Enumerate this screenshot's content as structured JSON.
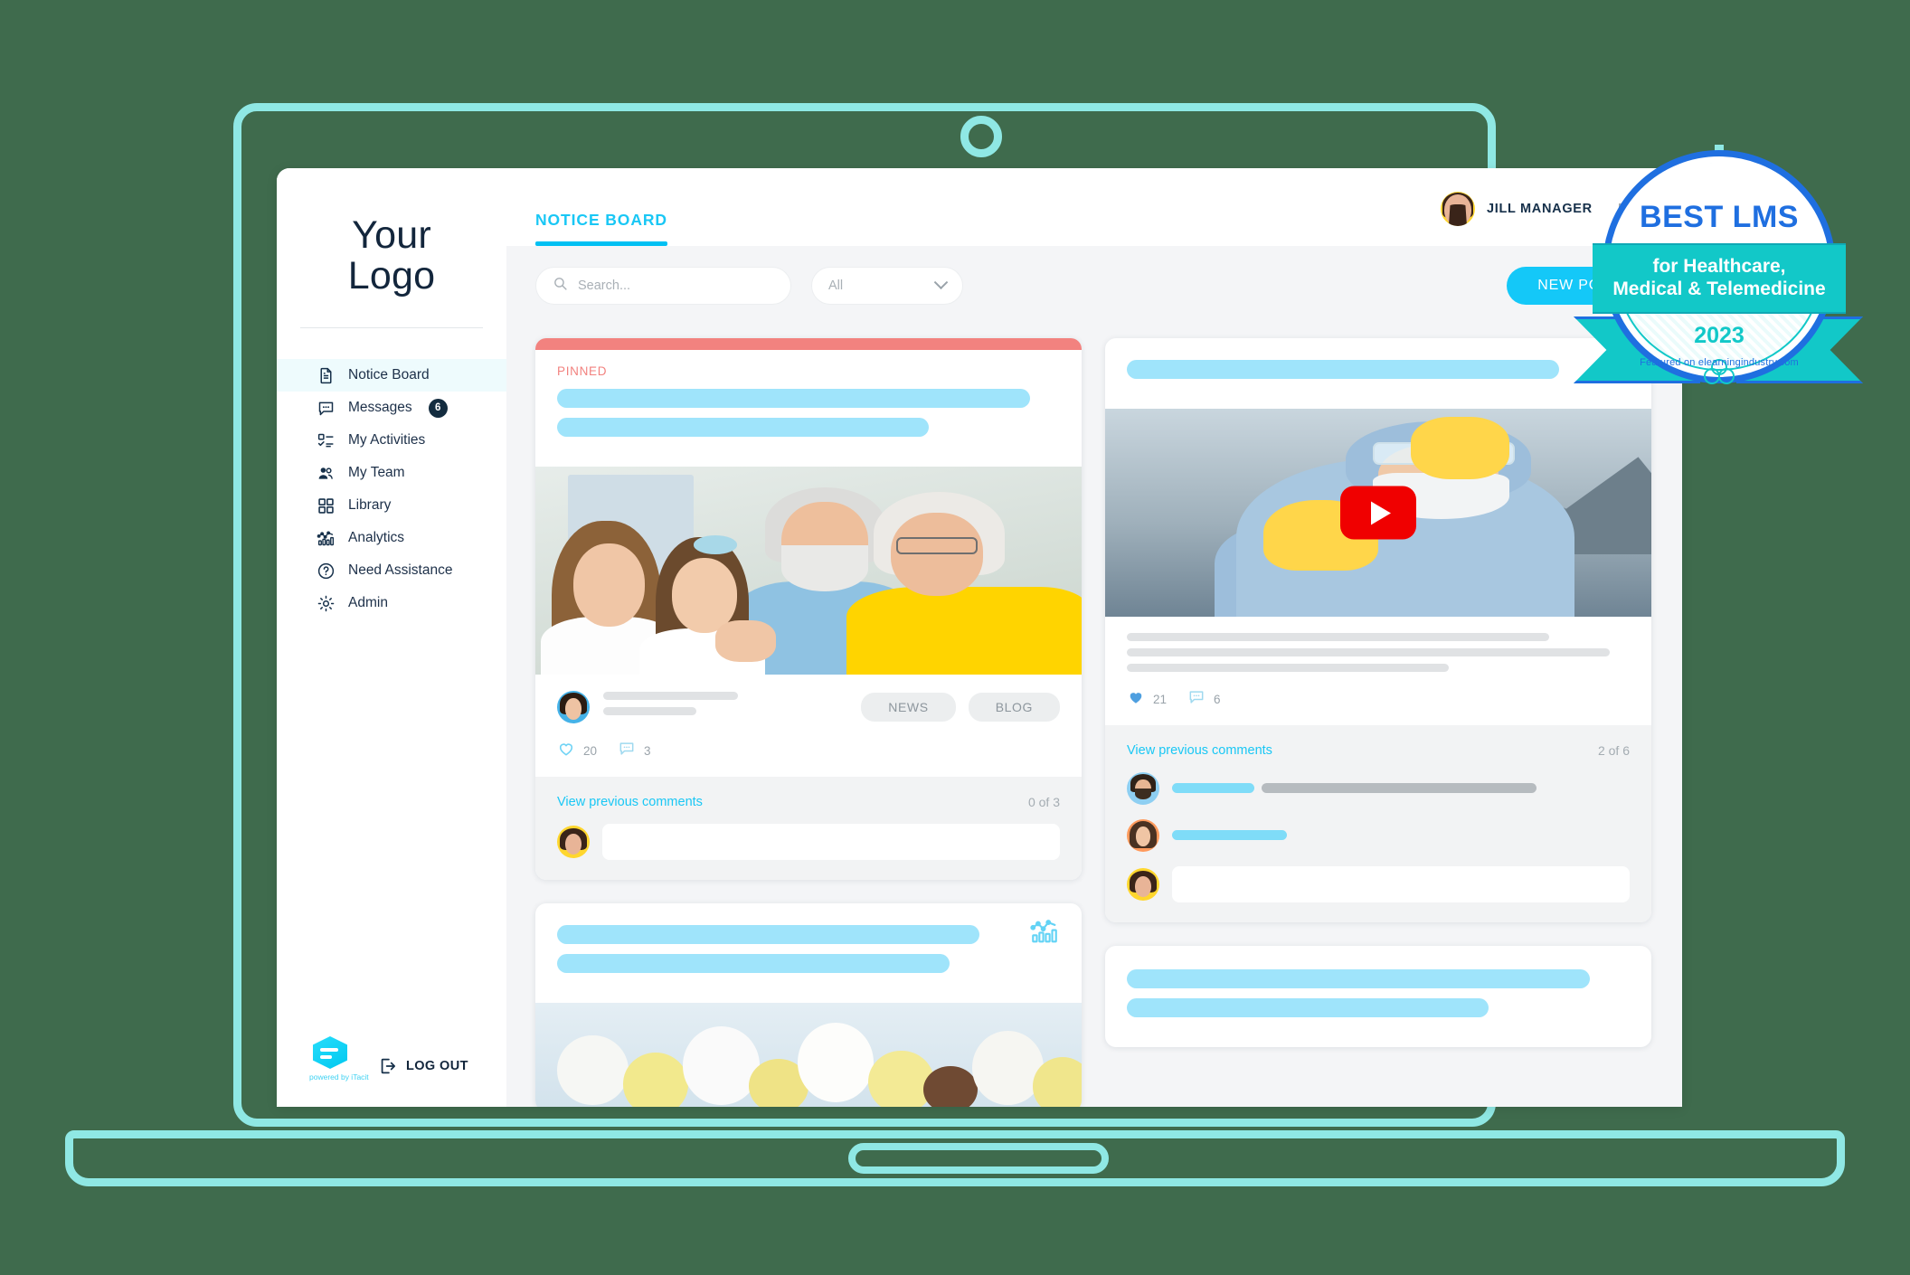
{
  "sidebar": {
    "logo_line1": "Your",
    "logo_line2": "Logo",
    "items": [
      {
        "label": "Notice Board",
        "icon": "document-icon",
        "active": true,
        "badge": ""
      },
      {
        "label": "Messages",
        "icon": "chat-icon",
        "active": false,
        "badge": "6"
      },
      {
        "label": "My Activities",
        "icon": "tasklist-icon",
        "active": false,
        "badge": ""
      },
      {
        "label": "My Team",
        "icon": "people-icon",
        "active": false,
        "badge": ""
      },
      {
        "label": "Library",
        "icon": "grid-icon",
        "active": false,
        "badge": ""
      },
      {
        "label": "Analytics",
        "icon": "analytics-icon",
        "active": false,
        "badge": ""
      },
      {
        "label": "Need Assistance",
        "icon": "help-icon",
        "active": false,
        "badge": ""
      },
      {
        "label": "Admin",
        "icon": "gear-icon",
        "active": false,
        "badge": ""
      }
    ],
    "powered_by": "powered by iTacit",
    "logout_label": "LOG OUT"
  },
  "header": {
    "tab_label": "NOTICE BOARD",
    "user_name": "JILL MANAGER",
    "language": "EN"
  },
  "toolbar": {
    "search_placeholder": "Search...",
    "search_value": "",
    "filter_value": "All",
    "new_post_label": "NEW POST"
  },
  "feed": {
    "pinned_card": {
      "pinned_label": "PINNED",
      "tags": [
        "NEWS",
        "BLOG"
      ],
      "likes": "20",
      "comments": "3",
      "view_comments_label": "View previous comments",
      "comments_shown": "0",
      "comments_of": "of",
      "comments_total": "3"
    },
    "video_card": {
      "likes": "21",
      "comments": "6",
      "view_comments_label": "View previous comments",
      "comments_shown": "2",
      "comments_of": "of",
      "comments_total": "6"
    }
  },
  "award": {
    "title": "BEST LMS",
    "line1": "for Healthcare,",
    "line2": "Medical & Telemedicine",
    "year": "2023",
    "featured": "Featured on elearningindustry.com"
  },
  "colors": {
    "accent": "#14c8f8",
    "pinned": "#f2827f",
    "badge_blue": "#1f6fe0",
    "badge_teal": "#12c8c8",
    "frame": "#8fe8e4"
  }
}
